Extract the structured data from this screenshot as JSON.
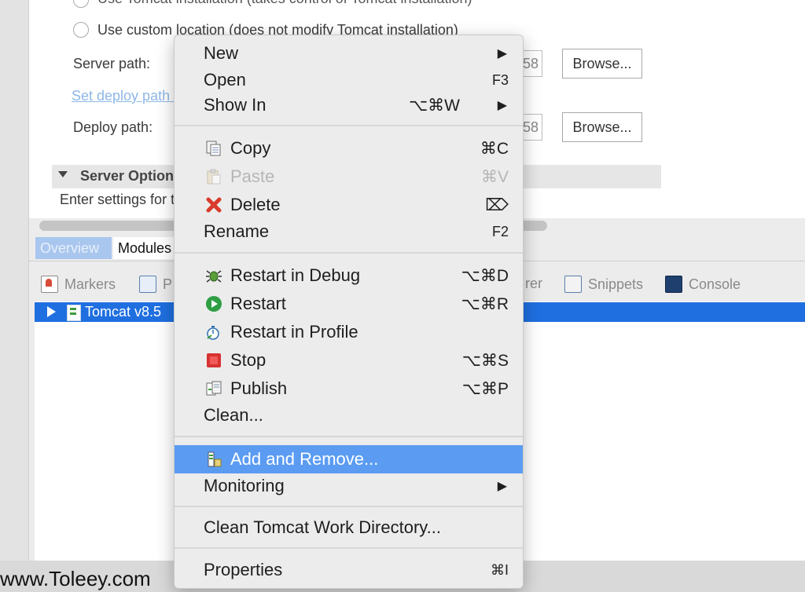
{
  "editor": {
    "radio_tomcat": "Use Tomcat installation (takes control of Tomcat installation)",
    "radio_custom": "Use custom location (does not modify Tomcat installation)",
    "server_path_label": "Server path:",
    "server_path_value_partial": "58",
    "browse_label": "Browse...",
    "set_deploy_link": "Set deploy path to the default value",
    "deploy_path_label": "Deploy path:",
    "deploy_path_value_partial": "58",
    "section_title": "Server Options",
    "section_desc": "Enter settings for the server."
  },
  "editor_tabs": {
    "overview": "Overview",
    "modules": "Modules"
  },
  "views": {
    "markers": "Markers",
    "properties_partial": "P",
    "explorer_partial": "rer",
    "snippets": "Snippets",
    "console": "Console"
  },
  "tree": {
    "server_label": "Tomcat v8.5"
  },
  "context_menu": {
    "new": "New",
    "open": "Open",
    "open_sc": "F3",
    "show_in": "Show In",
    "show_in_sc": "⌥⌘W",
    "copy": "Copy",
    "copy_sc": "⌘C",
    "paste": "Paste",
    "paste_sc": "⌘V",
    "delete": "Delete",
    "delete_sc": "⌦",
    "rename": "Rename",
    "rename_sc": "F2",
    "restart_debug": "Restart in Debug",
    "restart_debug_sc": "⌥⌘D",
    "restart": "Restart",
    "restart_sc": "⌥⌘R",
    "restart_profile": "Restart in Profile",
    "stop": "Stop",
    "stop_sc": "⌥⌘S",
    "publish": "Publish",
    "publish_sc": "⌥⌘P",
    "clean": "Clean...",
    "add_remove": "Add and Remove...",
    "monitoring": "Monitoring",
    "clean_work_dir": "Clean Tomcat Work Directory...",
    "properties": "Properties",
    "properties_sc": "⌘I"
  },
  "watermark": "www.Toleey.com",
  "colors": {
    "selection_blue": "#1f6fe0",
    "menu_highlight": "#5b9cf2",
    "link": "#8db8e6",
    "delete_red": "#d93a2b",
    "restart_green": "#2f9e44",
    "stop_red": "#d73232"
  }
}
